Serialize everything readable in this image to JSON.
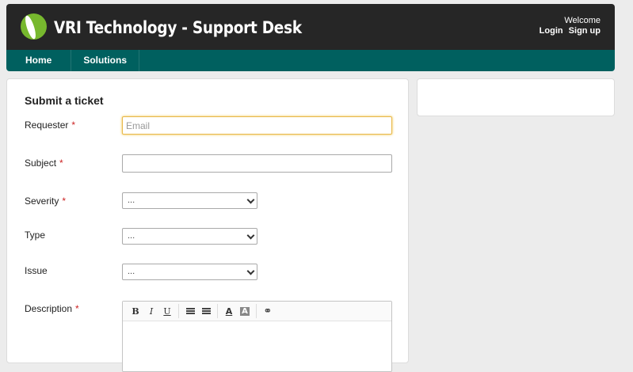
{
  "header": {
    "title": "VRI Technology - Support Desk",
    "welcome": "Welcome",
    "login": "Login",
    "signup": "Sign up"
  },
  "nav": {
    "items": [
      {
        "label": "Home"
      },
      {
        "label": "Solutions"
      }
    ]
  },
  "form": {
    "title": "Submit a ticket",
    "requester": {
      "label": "Requester",
      "required": "*",
      "placeholder": "Email",
      "value": ""
    },
    "subject": {
      "label": "Subject",
      "required": "*",
      "value": ""
    },
    "severity": {
      "label": "Severity",
      "required": "*",
      "selected": "..."
    },
    "type": {
      "label": "Type",
      "selected": "..."
    },
    "issue": {
      "label": "Issue",
      "selected": "..."
    },
    "description": {
      "label": "Description",
      "required": "*"
    }
  },
  "editor": {
    "tools": [
      "bold-icon",
      "italic-icon",
      "underline-icon",
      "bulleted-list-icon",
      "numbered-list-icon",
      "font-color-icon",
      "background-color-icon",
      "link-icon"
    ],
    "bold": "B",
    "italic": "I",
    "underline": "U",
    "font_color": "A",
    "bg_color": "A",
    "link": "⚭"
  },
  "colors": {
    "header_bg": "#262626",
    "nav_bg": "#00605f",
    "logo_green": "#77b82e",
    "required": "#cc2222",
    "focus": "#e8b84a"
  }
}
